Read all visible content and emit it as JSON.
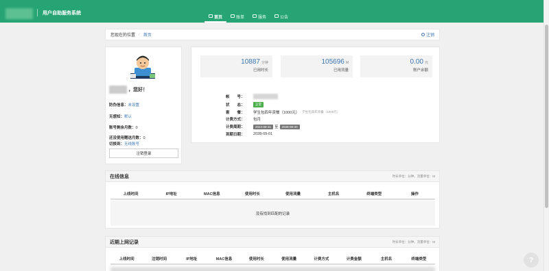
{
  "header": {
    "system_title": "用户自助服务系统",
    "nav": [
      {
        "label": "首页",
        "icon": "home-icon",
        "active": true
      },
      {
        "label": "账单",
        "icon": "bill-icon",
        "active": false
      },
      {
        "label": "服务",
        "icon": "service-icon",
        "active": false
      },
      {
        "label": "公告",
        "icon": "notice-icon",
        "active": false
      }
    ]
  },
  "breadcrumb": {
    "prefix": "您现在的位置",
    "current": "首页",
    "logout": "注销"
  },
  "profile": {
    "greeting": "，您好！",
    "rows": [
      {
        "label": "防伪信息：",
        "value": "未设置",
        "link": true
      },
      {
        "label": "无感知：",
        "value": "默认",
        "link": true
      },
      {
        "label": "账号剩余月数：",
        "value": "0",
        "link": false
      },
      {
        "label": "还没使用赠送月数：",
        "value": "0",
        "link": false
      },
      {
        "label": "切换到：",
        "value": "无线账号",
        "link": true
      }
    ],
    "logout_button": "注销登录"
  },
  "stats": [
    {
      "value": "10887",
      "unit": "分钟",
      "label": "已用时长"
    },
    {
      "value": "105696",
      "unit": "M",
      "label": "已用流量"
    },
    {
      "value": "0.00",
      "unit": "元",
      "label": "账户余额"
    }
  ],
  "account": {
    "account_label": "帐　　号：",
    "status_label": "状　　态：",
    "status_value": "正常",
    "package_label": "套　　餐：",
    "package_value": "学生包四年资餐（1000元）",
    "package_note": "学生包四年资餐（1000元）",
    "billing_label": "计费方式：",
    "billing_value": "包月",
    "period_label": "计费周期：",
    "period_start": "2024-08-31",
    "period_to": "至",
    "period_end": "2028-08-30",
    "expire_label": "到期日期：",
    "expire_value": "2028-09-01"
  },
  "online": {
    "title": "在线信息",
    "unit_note": "时长单位：分钟，流量单位：M",
    "columns": [
      "上线时间",
      "IP地址",
      "MAC信息",
      "使用时长",
      "使用流量",
      "主机名",
      "终端类型",
      "操作"
    ],
    "empty_text": "没有找到匹配的记录"
  },
  "recent": {
    "title": "近期上网记录",
    "unit_note": "时长单位：分钟，流量单位：M",
    "columns": [
      "上线时间",
      "注销时间",
      "IP地址",
      "MAC信息",
      "使用时长",
      "使用流量",
      "计费方式",
      "计费金额",
      "主机名",
      "终端类型"
    ]
  },
  "colors": {
    "brand": "#27a474",
    "link": "#3a76b3"
  }
}
